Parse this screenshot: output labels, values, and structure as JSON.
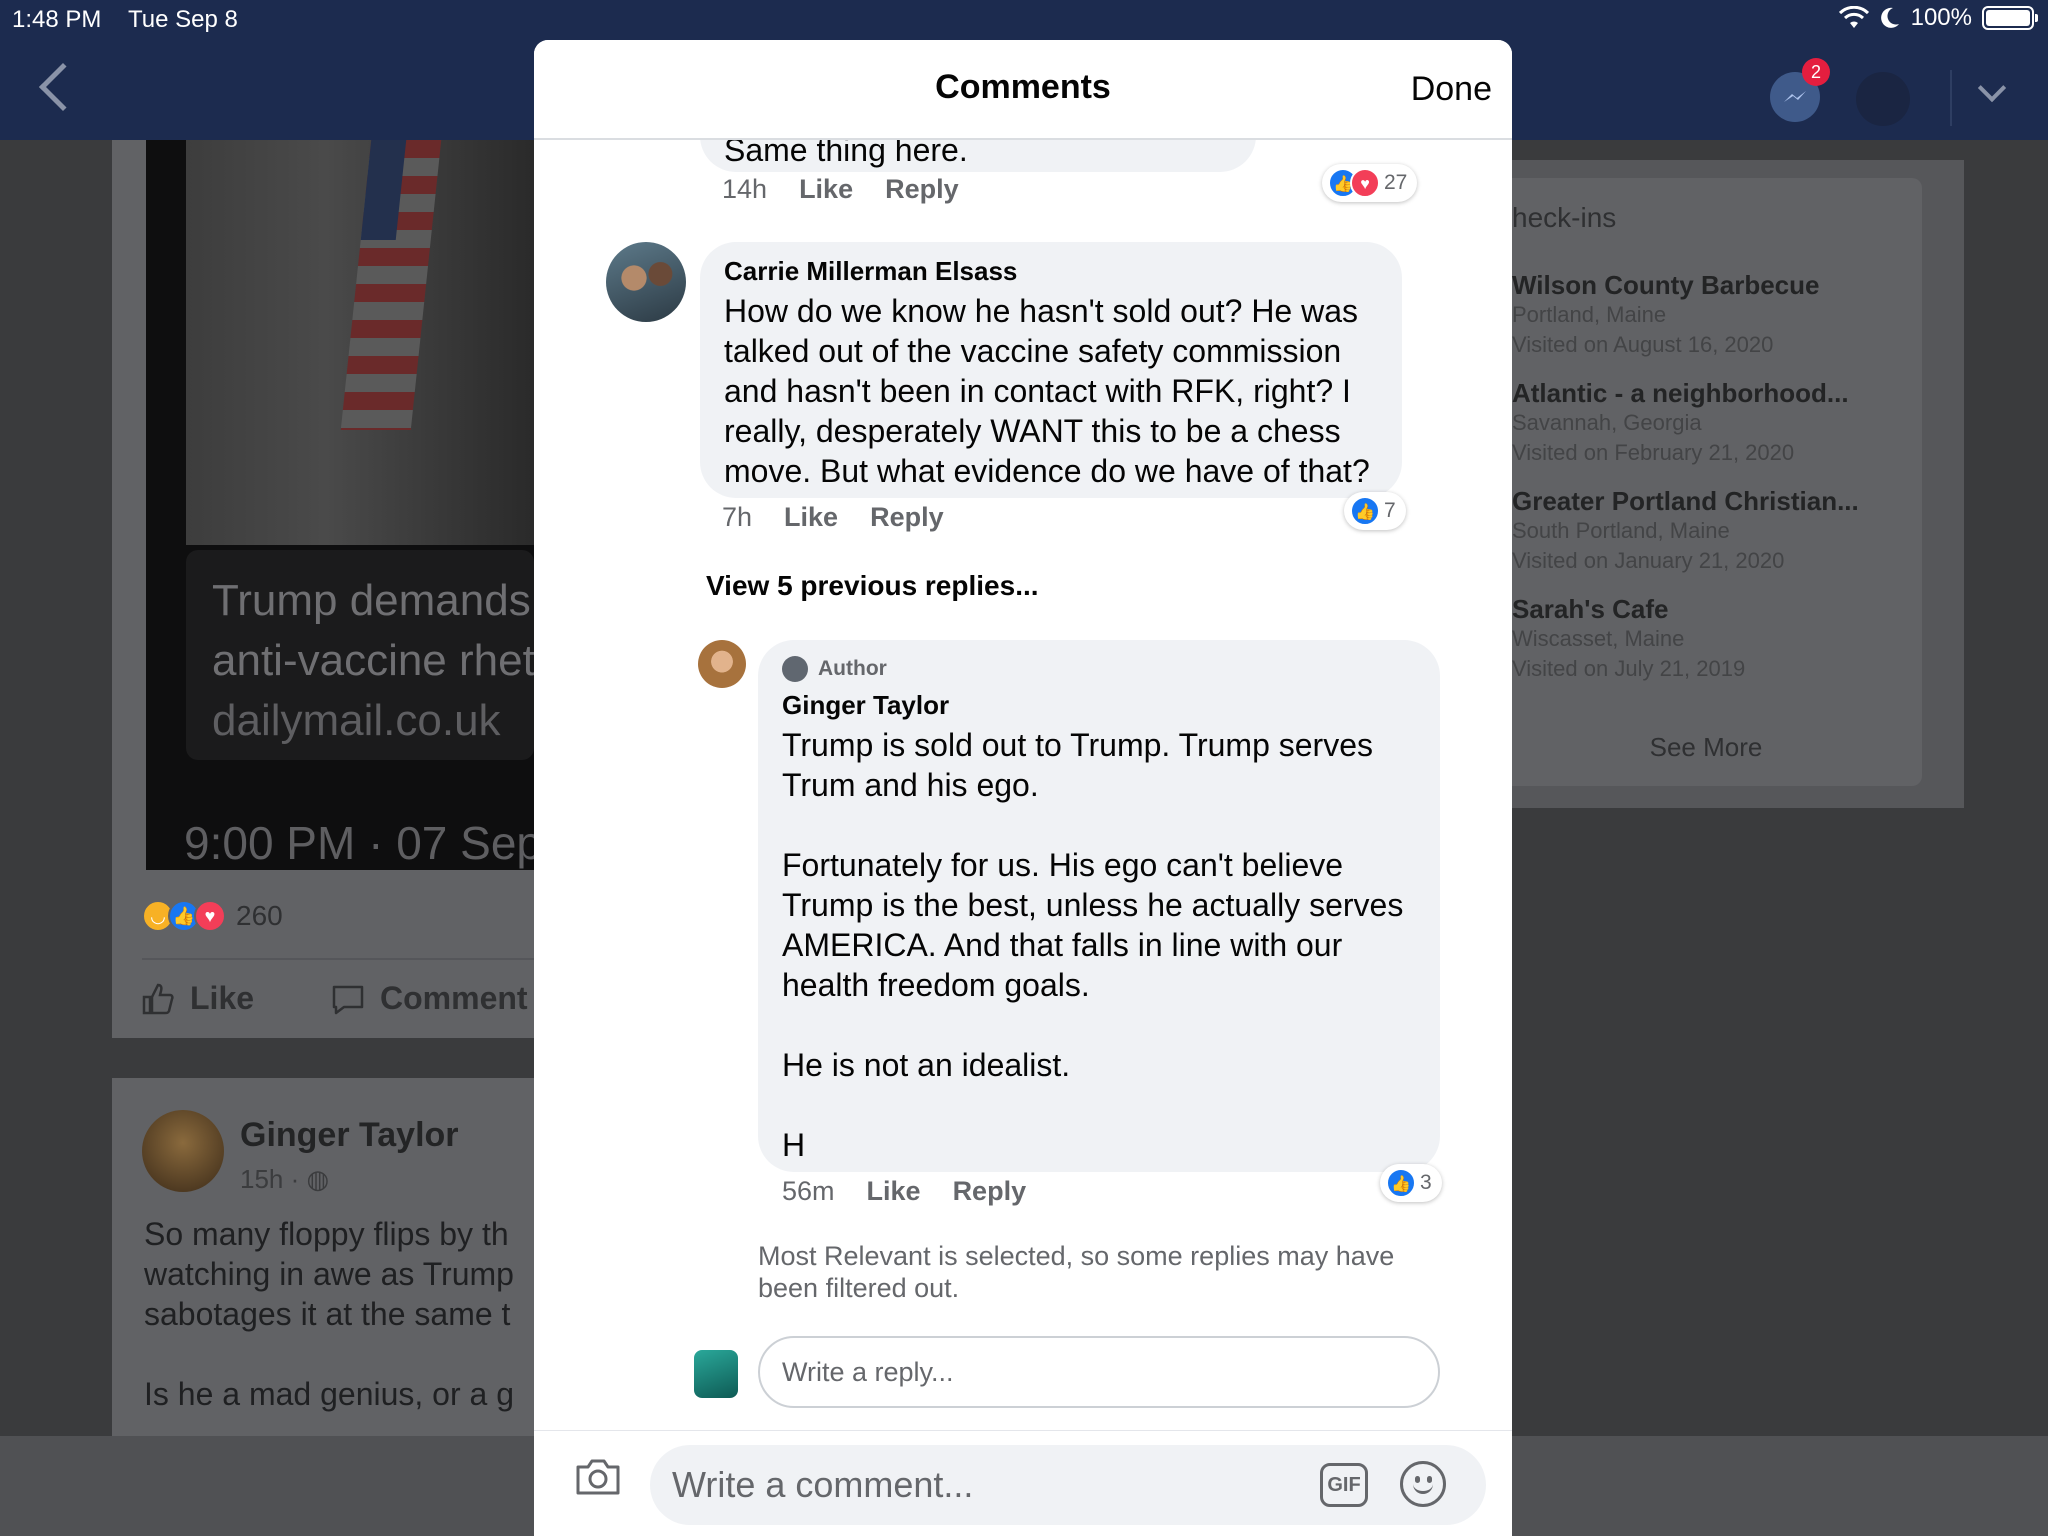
{
  "status_bar": {
    "time": "1:48 PM",
    "date": "Tue Sep 8",
    "battery": "100%"
  },
  "nav": {
    "messenger_badge": "2"
  },
  "background": {
    "link_title_line1": "Trump demands",
    "link_title_line2": "anti-vaccine rhet",
    "link_domain": "dailymail.co.uk",
    "timestamp": "9:00 PM · 07 Sep",
    "reaction_count": "260",
    "like_label": "Like",
    "comment_label": "Comment",
    "post_author": "Ginger Taylor",
    "post_meta": "15h ·",
    "post_text": "So many floppy flips by th\nwatching in awe as Trump\nsabotages it at the same t\n\nIs he a mad genius, or a g",
    "checkins_title": "heck-ins",
    "checkins": [
      {
        "name": "Wilson County Barbecue",
        "place": "Portland, Maine",
        "visited": "Visited on August 16, 2020"
      },
      {
        "name": "Atlantic - a neighborhood...",
        "place": "Savannah, Georgia",
        "visited": "Visited on February 21, 2020"
      },
      {
        "name": "Greater Portland Christian...",
        "place": "South Portland, Maine",
        "visited": "Visited on January 21, 2020"
      },
      {
        "name": "Sarah's Cafe",
        "place": "Wiscasset, Maine",
        "visited": "Visited on July 21, 2019"
      }
    ],
    "see_more": "See More"
  },
  "modal": {
    "title": "Comments",
    "done_label": "Done",
    "comments": [
      {
        "text": "Same thing here.",
        "time": "14h",
        "like": "Like",
        "reply": "Reply",
        "reactions": "27"
      },
      {
        "name": "Carrie Millerman Elsass",
        "text": "How do we know he hasn't sold out? He was talked out of the vaccine safety commission and hasn't been in contact with RFK, right? I really, desperately WANT this to be a chess move. But what evidence do we have of that?",
        "time": "7h",
        "like": "Like",
        "reply": "Reply",
        "reactions": "7"
      }
    ],
    "view_previous": "View 5 previous replies...",
    "reply": {
      "author_tag": "Author",
      "name": "Ginger Taylor",
      "text": "Trump is sold out to Trump. Trump serves Trum and his ego.\n\nFortunately for us. His ego can't believe Trump is the best, unless he actually serves AMERICA. And that falls in line with our health freedom goals.\n\nHe is not an idealist.\n\nH",
      "time": "56m",
      "like": "Like",
      "reply_label": "Reply",
      "reactions": "3"
    },
    "filter_note": "Most Relevant is selected, so some replies may have been filtered out.",
    "reply_placeholder": "Write a reply...",
    "comment_placeholder": "Write a comment...",
    "gif_label": "GIF"
  },
  "colors": {
    "nav_bg": "#1c2b4f",
    "like_blue": "#1877f2",
    "love_red": "#f33e58",
    "bubble": "#f0f2f5"
  }
}
